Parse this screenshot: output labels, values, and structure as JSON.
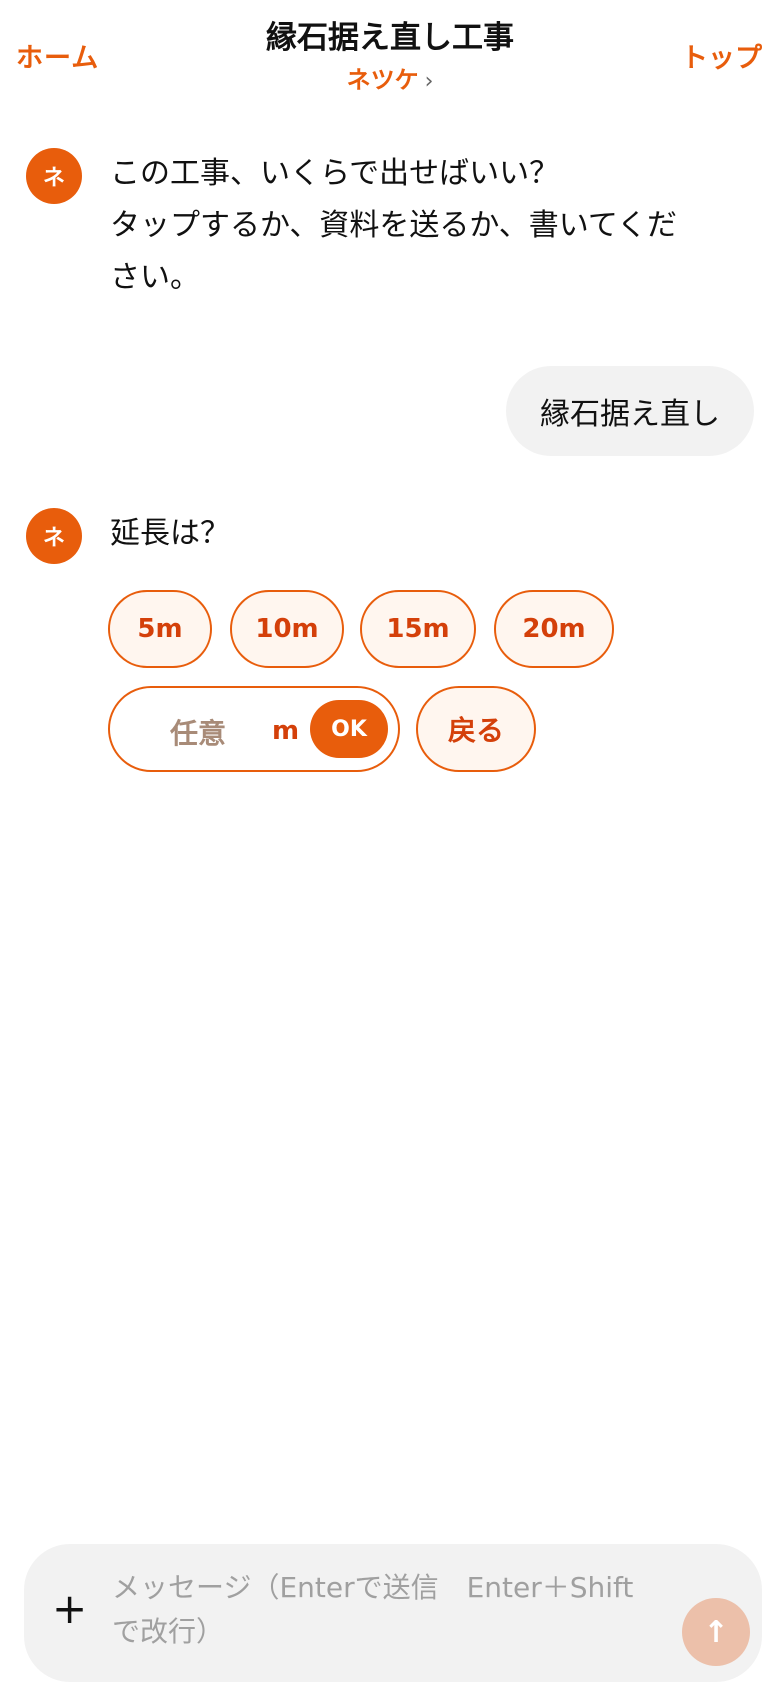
{
  "header": {
    "home_label": "ホーム",
    "title": "縁石据え直し工事",
    "subtitle": "ネツケ",
    "subtitle_chevron": "›",
    "top_label": "トップ"
  },
  "messages": [
    {
      "role": "bot",
      "avatar": "ネ",
      "lines": [
        "この工事、いくらで出せばいい？",
        "タップするか、資料を送るか、書いてくだ",
        "さい。"
      ]
    },
    {
      "role": "user",
      "text": "縁石据え直し"
    },
    {
      "role": "bot",
      "avatar": "ネ",
      "lines": [
        "延長は？"
      ]
    }
  ],
  "options": {
    "chips": [
      "5m",
      "10m",
      "15m",
      "20m"
    ],
    "custom_placeholder": "任意",
    "custom_unit": "m",
    "ok_label": "OK",
    "back_label": "戻る"
  },
  "composer": {
    "plus_icon": "+",
    "placeholder": "メッセージ（Enterで送信　Enter＋Shiftで改行）",
    "send_icon": "↑"
  },
  "colors": {
    "accent": "#e85d0c",
    "chip_bg": "#fff6ef",
    "chip_text": "#d4400a",
    "bubble_bg": "#f2f2f2",
    "send_disabled": "#ecc0aa"
  }
}
